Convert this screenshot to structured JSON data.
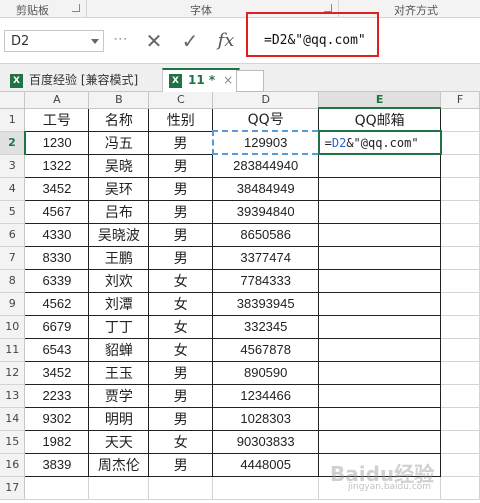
{
  "ribbon": {
    "clipboard_label": "剪贴板",
    "font_label": "字体",
    "align_label": "对齐方式"
  },
  "formula_bar": {
    "name_box": "D2",
    "cancel_icon": "close-icon",
    "enter_icon": "check-icon",
    "fx_label": "fx",
    "formula": "=D2&\"@qq.com\""
  },
  "tabs": [
    {
      "label": "百度经验 [兼容模式]",
      "active": false
    },
    {
      "label": "11 *",
      "active": true,
      "close": "×"
    }
  ],
  "columns": [
    "A",
    "B",
    "C",
    "D",
    "E",
    "F"
  ],
  "rows": [
    {
      "num": "1",
      "cells": [
        "工号",
        "名称",
        "性别",
        "QQ号",
        "QQ邮箱"
      ]
    },
    {
      "num": "2",
      "cells": [
        "1230",
        "冯五",
        "男",
        "129903",
        "=D2&\"@qq.com\""
      ]
    },
    {
      "num": "3",
      "cells": [
        "1322",
        "吴晓",
        "男",
        "283844940",
        ""
      ]
    },
    {
      "num": "4",
      "cells": [
        "3452",
        "吴环",
        "男",
        "38484949",
        ""
      ]
    },
    {
      "num": "5",
      "cells": [
        "4567",
        "吕布",
        "男",
        "39394840",
        ""
      ]
    },
    {
      "num": "6",
      "cells": [
        "4330",
        "吴晓波",
        "男",
        "8650586",
        ""
      ]
    },
    {
      "num": "7",
      "cells": [
        "8330",
        "王鹏",
        "男",
        "3377474",
        ""
      ]
    },
    {
      "num": "8",
      "cells": [
        "6339",
        "刘欢",
        "女",
        "7784333",
        ""
      ]
    },
    {
      "num": "9",
      "cells": [
        "4562",
        "刘潭",
        "女",
        "38393945",
        ""
      ]
    },
    {
      "num": "10",
      "cells": [
        "6679",
        "丁丁",
        "女",
        "332345",
        ""
      ]
    },
    {
      "num": "11",
      "cells": [
        "6543",
        "貂蝉",
        "女",
        "4567878",
        ""
      ]
    },
    {
      "num": "12",
      "cells": [
        "3452",
        "王玉",
        "男",
        "890590",
        ""
      ]
    },
    {
      "num": "13",
      "cells": [
        "2233",
        "贾学",
        "男",
        "1234466",
        ""
      ]
    },
    {
      "num": "14",
      "cells": [
        "9302",
        "明明",
        "男",
        "1028303",
        ""
      ]
    },
    {
      "num": "15",
      "cells": [
        "1982",
        "天天",
        "女",
        "90303833",
        ""
      ]
    },
    {
      "num": "16",
      "cells": [
        "3839",
        "周杰伦",
        "男",
        "4448005",
        ""
      ]
    },
    {
      "num": "17",
      "cells": [
        "",
        "",
        "",
        "",
        ""
      ]
    }
  ],
  "active_cell_display": {
    "ref": "D2",
    "rest": "&\"@qq.com\""
  },
  "watermark": "Baidu经验",
  "watermark_sub": "jingyan.baidu.com",
  "colors": {
    "accent": "#217346",
    "red_highlight": "#e02020",
    "ref_blue": "#2b63d6"
  }
}
